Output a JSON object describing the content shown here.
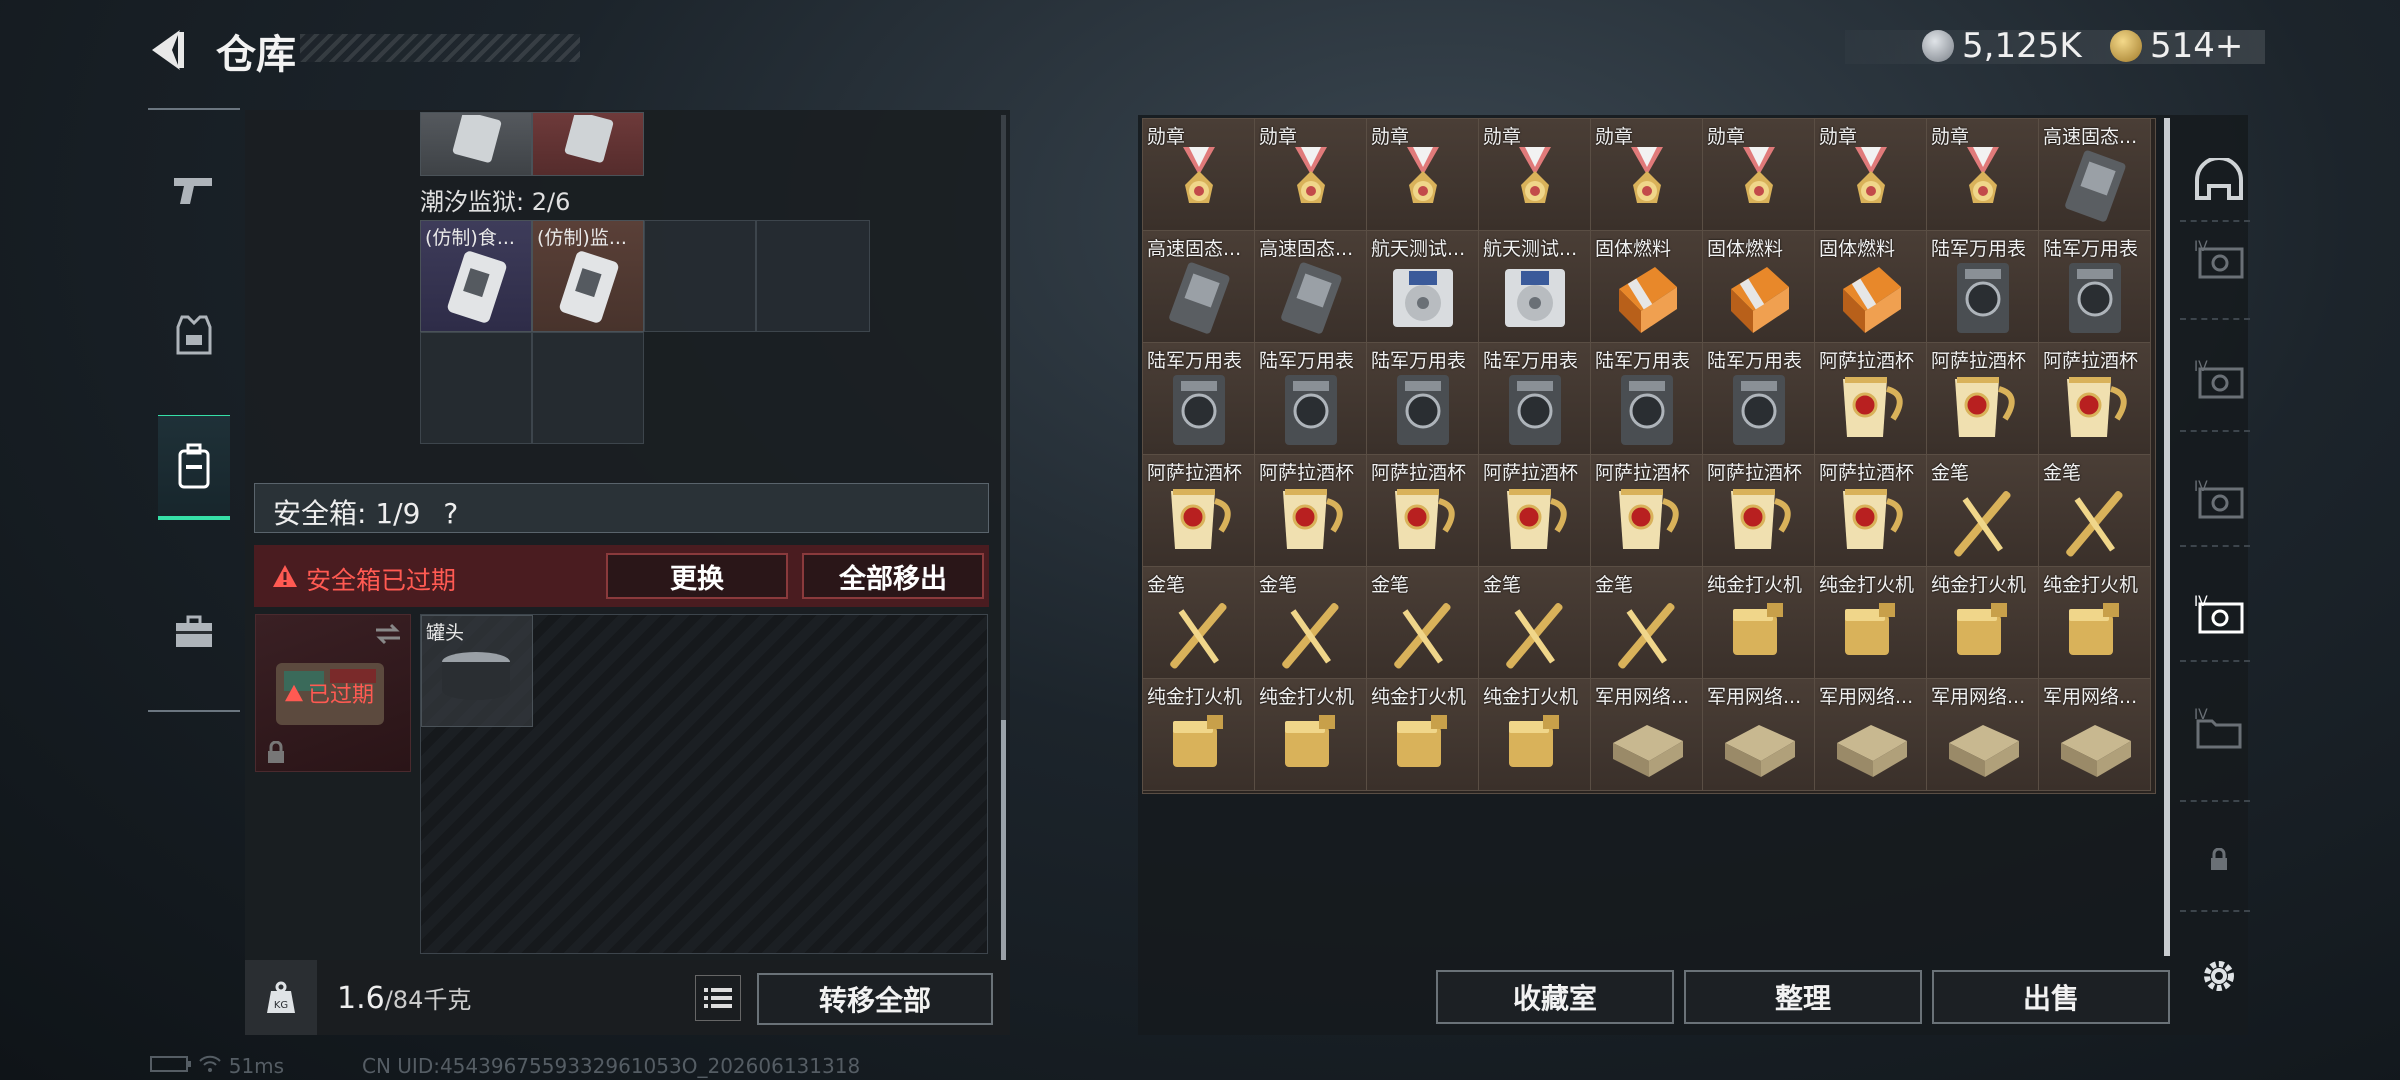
{
  "header": {
    "title": "仓库",
    "currency1": "5,125K",
    "currency2": "514+"
  },
  "left": {
    "prison_label": "潮汐监狱: 2/6",
    "prison_items": [
      "(仿制)食...",
      "(仿制)监..."
    ],
    "safe_label": "安全箱: 1/9",
    "safe_help": "?",
    "expired_text": "安全箱已过期",
    "replace_btn": "更换",
    "move_all_btn": "全部移出",
    "box_status": "已过期",
    "can_item": "罐头",
    "weight_value": "1.6",
    "weight_max": "/84千克",
    "kg_label": "KG",
    "transfer_all": "转移全部"
  },
  "inventory": {
    "items": [
      {
        "label": "勋章",
        "icon": "medal"
      },
      {
        "label": "勋章",
        "icon": "medal"
      },
      {
        "label": "勋章",
        "icon": "medal"
      },
      {
        "label": "勋章",
        "icon": "medal"
      },
      {
        "label": "勋章",
        "icon": "medal"
      },
      {
        "label": "勋章",
        "icon": "medal"
      },
      {
        "label": "勋章",
        "icon": "medal"
      },
      {
        "label": "勋章",
        "icon": "medal"
      },
      {
        "label": "高速固态...",
        "icon": "ssd"
      },
      {
        "label": "高速固态...",
        "icon": "ssd"
      },
      {
        "label": "高速固态...",
        "icon": "ssd"
      },
      {
        "label": "航天测试...",
        "icon": "disk"
      },
      {
        "label": "航天测试...",
        "icon": "disk"
      },
      {
        "label": "固体燃料",
        "icon": "fuel"
      },
      {
        "label": "固体燃料",
        "icon": "fuel"
      },
      {
        "label": "固体燃料",
        "icon": "fuel"
      },
      {
        "label": "陆军万用表",
        "icon": "meter"
      },
      {
        "label": "陆军万用表",
        "icon": "meter"
      },
      {
        "label": "陆军万用表",
        "icon": "meter"
      },
      {
        "label": "陆军万用表",
        "icon": "meter"
      },
      {
        "label": "陆军万用表",
        "icon": "meter"
      },
      {
        "label": "陆军万用表",
        "icon": "meter"
      },
      {
        "label": "陆军万用表",
        "icon": "meter"
      },
      {
        "label": "陆军万用表",
        "icon": "meter"
      },
      {
        "label": "阿萨拉酒杯",
        "icon": "cup"
      },
      {
        "label": "阿萨拉酒杯",
        "icon": "cup"
      },
      {
        "label": "阿萨拉酒杯",
        "icon": "cup"
      },
      {
        "label": "阿萨拉酒杯",
        "icon": "cup"
      },
      {
        "label": "阿萨拉酒杯",
        "icon": "cup"
      },
      {
        "label": "阿萨拉酒杯",
        "icon": "cup"
      },
      {
        "label": "阿萨拉酒杯",
        "icon": "cup"
      },
      {
        "label": "阿萨拉酒杯",
        "icon": "cup"
      },
      {
        "label": "阿萨拉酒杯",
        "icon": "cup"
      },
      {
        "label": "阿萨拉酒杯",
        "icon": "cup"
      },
      {
        "label": "金笔",
        "icon": "pen"
      },
      {
        "label": "金笔",
        "icon": "pen"
      },
      {
        "label": "金笔",
        "icon": "pen"
      },
      {
        "label": "金笔",
        "icon": "pen"
      },
      {
        "label": "金笔",
        "icon": "pen"
      },
      {
        "label": "金笔",
        "icon": "pen"
      },
      {
        "label": "金笔",
        "icon": "pen"
      },
      {
        "label": "纯金打火机",
        "icon": "lighter"
      },
      {
        "label": "纯金打火机",
        "icon": "lighter"
      },
      {
        "label": "纯金打火机",
        "icon": "lighter"
      },
      {
        "label": "纯金打火机",
        "icon": "lighter"
      },
      {
        "label": "纯金打火机",
        "icon": "lighter"
      },
      {
        "label": "纯金打火机",
        "icon": "lighter"
      },
      {
        "label": "纯金打火机",
        "icon": "lighter"
      },
      {
        "label": "纯金打火机",
        "icon": "lighter"
      },
      {
        "label": "军用网络...",
        "icon": "router"
      },
      {
        "label": "军用网络...",
        "icon": "router"
      },
      {
        "label": "军用网络...",
        "icon": "router"
      },
      {
        "label": "军用网络...",
        "icon": "router"
      },
      {
        "label": "军用网络...",
        "icon": "router"
      }
    ]
  },
  "right_buttons": {
    "collection": "收藏室",
    "sort": "整理",
    "sell": "出售"
  },
  "right_nav": {
    "level_badge": "IV"
  },
  "footer": {
    "ping": "51ms",
    "uid": "CN UID:4543967559332961053O_202606131318"
  },
  "colors": {
    "accent": "#36e0a8",
    "danger": "#ff5a52",
    "gold": "#d9b25a"
  }
}
